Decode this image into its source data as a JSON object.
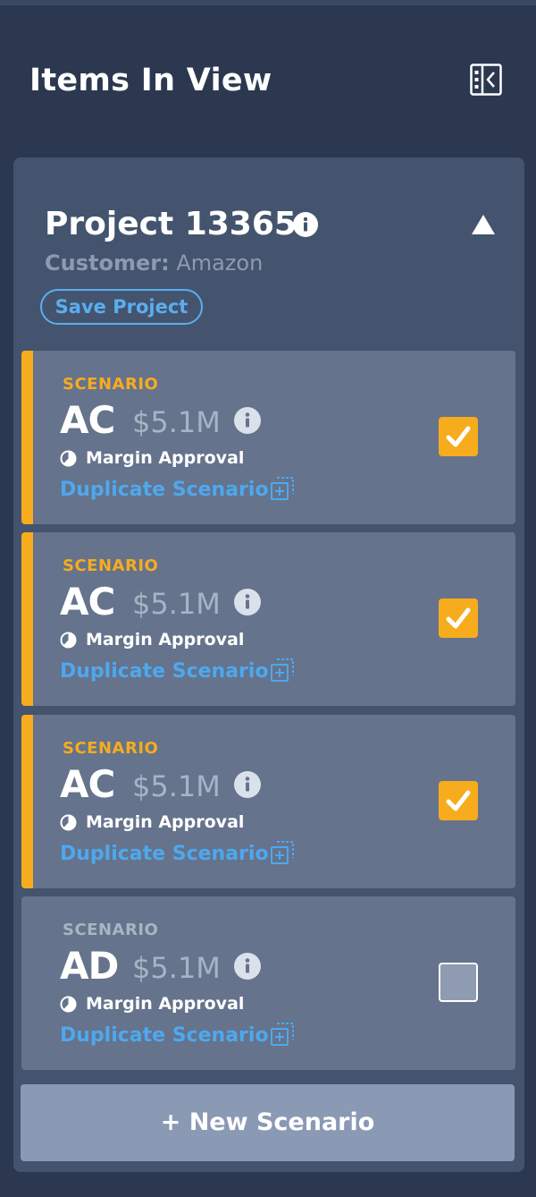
{
  "header": {
    "title": "Items In View"
  },
  "project": {
    "title": "Project 13365",
    "customer_label": "Customer:",
    "customer_value": "Amazon",
    "save_label": "Save Project"
  },
  "scenarios": [
    {
      "label": "SCENARIO",
      "name": "AC",
      "amount": "$5.1M",
      "status": "Margin Approval",
      "duplicate_label": "Duplicate Scenario",
      "selected": true
    },
    {
      "label": "SCENARIO",
      "name": "AC",
      "amount": "$5.1M",
      "status": "Margin Approval",
      "duplicate_label": "Duplicate Scenario",
      "selected": true
    },
    {
      "label": "SCENARIO",
      "name": "AC",
      "amount": "$5.1M",
      "status": "Margin Approval",
      "duplicate_label": "Duplicate Scenario",
      "selected": true
    },
    {
      "label": "SCENARIO",
      "name": "AD",
      "amount": "$5.1M",
      "status": "Margin Approval",
      "duplicate_label": "Duplicate Scenario",
      "selected": false
    }
  ],
  "new_scenario_label": "+ New Scenario",
  "icons": {
    "collapse_panel": "panel-collapse-icon",
    "project_info": "info-icon",
    "collapse_arrow": "triangle-up-icon",
    "status": "pie-chart-icon",
    "duplicate": "duplicate-icon",
    "check": "checkmark-icon"
  },
  "colors": {
    "background": "#2b384f",
    "card": "#44546e",
    "scenario_card": "#65738c",
    "accent_orange": "#f7ac1d",
    "link_blue": "#4ea8ee",
    "new_button": "#8a99b4"
  }
}
